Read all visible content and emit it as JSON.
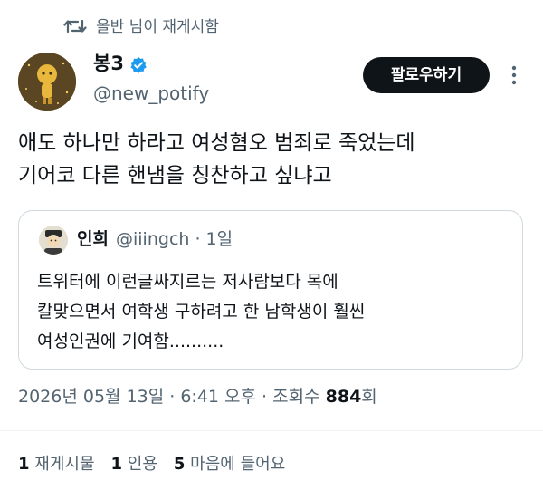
{
  "repost_banner": {
    "text": "올반 님이 재게시함",
    "icon": "repost-icon"
  },
  "author": {
    "display_name": "봉3",
    "handle": "@new_potify",
    "verified": true,
    "follow_label": "팔로우하기"
  },
  "tweet": {
    "lines": [
      "애도 하나만 하라고 여성혐오 범죄로 죽었는데",
      "기어코 다른 핸냄을 칭찬하고 싶냐고"
    ]
  },
  "quote": {
    "display_name": "인희",
    "handle_time": "@iiingch · 1일",
    "lines": [
      "트위터에 이런글싸지르는 저사람보다 목에",
      "칼맞으면서 여학생 구하려고 한 남학생이 훨씬",
      "여성인권에 기여함.........."
    ]
  },
  "meta": {
    "timestamp": "2026년 05월 13일 · 6:41 오후 · 조회수 ",
    "views": "884",
    "views_suffix": "회"
  },
  "stats": {
    "reposts_count": "1",
    "reposts_label": "재게시물",
    "quotes_count": "1",
    "quotes_label": "인용",
    "likes_count": "5",
    "likes_label": "마음에 들어요"
  },
  "colors": {
    "accent": "#1d9bf0",
    "text": "#0f1419",
    "muted": "#536471",
    "border": "#cfd9de"
  }
}
